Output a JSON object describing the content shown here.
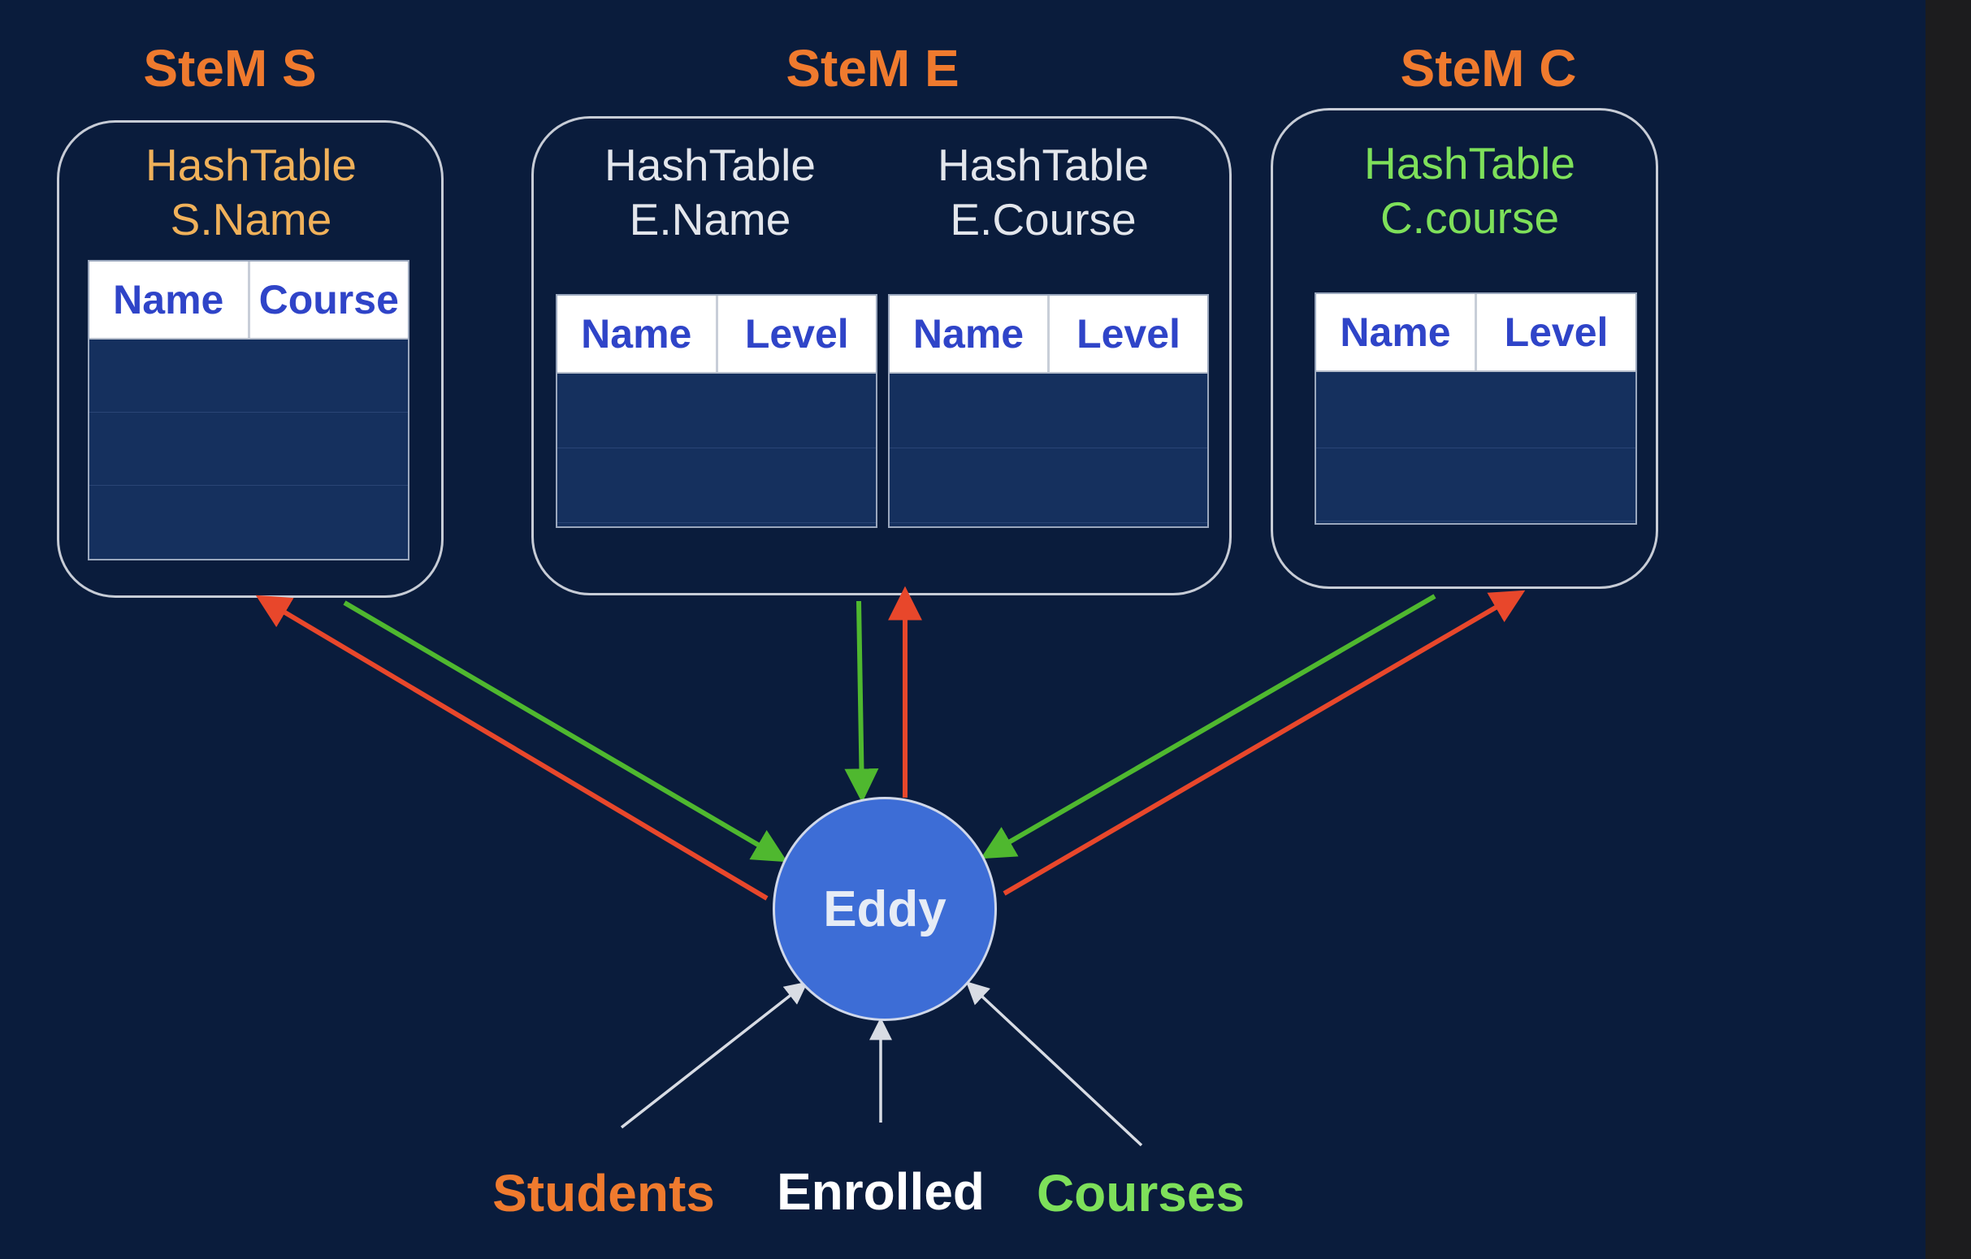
{
  "colors": {
    "background": "#0a1c3c",
    "title_orange": "#ef7a2e",
    "hashtable_tan": "#f0b15a",
    "hashtable_green": "#7ee05a",
    "hashtable_white": "#e3e6ec",
    "arrow_red": "#e8472b",
    "arrow_green": "#4fb82f",
    "arrow_white": "#d8dce4",
    "eddy_fill": "#3d6dd6",
    "header_text": "#2f44c8"
  },
  "stems": [
    {
      "title": "SteM S",
      "tables": [
        {
          "label_line1": "HashTable",
          "label_line2": "S.Name",
          "columns": [
            "Name",
            "Course"
          ]
        }
      ]
    },
    {
      "title": "SteM E",
      "tables": [
        {
          "label_line1": "HashTable",
          "label_line2": "E.Name",
          "columns": [
            "Name",
            "Level"
          ]
        },
        {
          "label_line1": "HashTable",
          "label_line2": "E.Course",
          "columns": [
            "Name",
            "Level"
          ]
        }
      ]
    },
    {
      "title": "SteM C",
      "tables": [
        {
          "label_line1": "HashTable",
          "label_line2": "C.course",
          "columns": [
            "Name",
            "Level"
          ]
        }
      ]
    }
  ],
  "eddy": {
    "label": "Eddy"
  },
  "sources": [
    {
      "label": "Students",
      "color": "#ef7a2e"
    },
    {
      "label": "Enrolled",
      "color": "#ffffff"
    },
    {
      "label": "Courses",
      "color": "#7ee05a"
    }
  ]
}
